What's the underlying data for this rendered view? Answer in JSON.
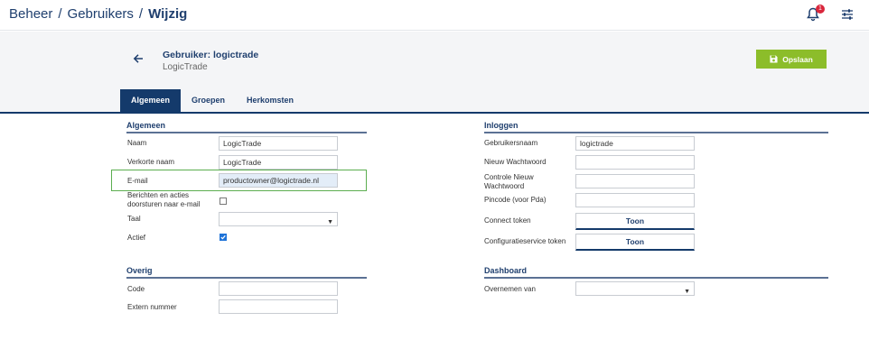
{
  "breadcrumb": {
    "items": [
      "Beheer",
      "Gebruikers"
    ],
    "current": "Wijzig",
    "separator": "/"
  },
  "notifications": {
    "count": "1"
  },
  "header": {
    "title": "Gebruiker: logictrade",
    "subtitle": "LogicTrade",
    "save_label": "Opslaan"
  },
  "tabs": [
    {
      "label": "Algemeen",
      "active": true
    },
    {
      "label": "Groepen"
    },
    {
      "label": "Herkomsten"
    }
  ],
  "algemeen": {
    "title": "Algemeen",
    "naam": {
      "label": "Naam",
      "value": "LogicTrade"
    },
    "verkorte_naam": {
      "label": "Verkorte naam",
      "value": "LogicTrade"
    },
    "email": {
      "label": "E-mail",
      "value": "productowner@logictrade.nl"
    },
    "berichten": {
      "label_line1": "Berichten en acties",
      "label_line2": "doorsturen naar e-mail",
      "checked": false
    },
    "taal": {
      "label": "Taal",
      "value": ""
    },
    "actief": {
      "label": "Actief",
      "checked": true
    }
  },
  "overig": {
    "title": "Overig",
    "code": {
      "label": "Code",
      "value": ""
    },
    "extern": {
      "label": "Extern nummer",
      "value": ""
    }
  },
  "inloggen": {
    "title": "Inloggen",
    "gebruikersnaam": {
      "label": "Gebruikersnaam",
      "value": "logictrade"
    },
    "nieuw_ww": {
      "label": "Nieuw Wachtwoord",
      "value": ""
    },
    "controle_ww": {
      "label_line1": "Controle Nieuw",
      "label_line2": "Wachtwoord",
      "value": ""
    },
    "pincode": {
      "label": "Pincode (voor Pda)",
      "value": ""
    },
    "connect_token": {
      "label": "Connect token",
      "button": "Toon"
    },
    "config_token": {
      "label": "Configuratieservice token",
      "button": "Toon"
    }
  },
  "dashboard": {
    "title": "Dashboard",
    "overnemen": {
      "label": "Overnemen van",
      "value": ""
    }
  },
  "colors": {
    "primary": "#143a6b",
    "save": "#8cbd2a",
    "badge": "#d9263b",
    "checkbox": "#1f73d8",
    "highlight_border": "#5cae50"
  },
  "icons": {
    "bell": "bell-icon",
    "settings": "sliders-icon",
    "back": "arrow-left-icon",
    "save": "floppy-disk-icon",
    "dropdown": "caret-down-icon",
    "check": "check-icon"
  }
}
